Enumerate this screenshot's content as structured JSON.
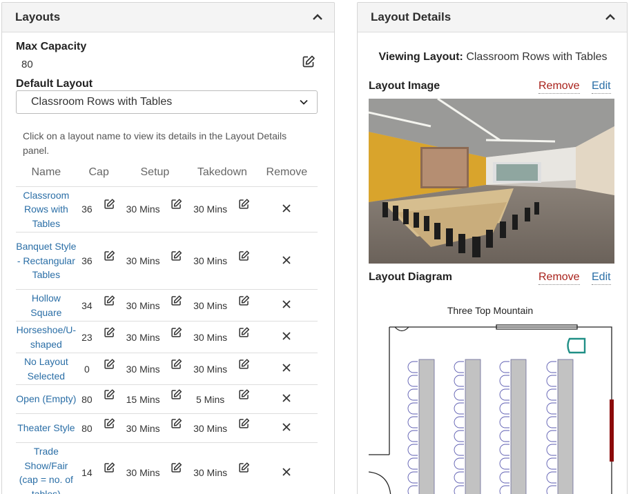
{
  "layouts_panel": {
    "title": "Layouts",
    "max_capacity_label": "Max Capacity",
    "max_capacity_value": "80",
    "default_layout_label": "Default Layout",
    "default_layout_value": "Classroom Rows with Tables",
    "help_text": "Click on a layout name to view its details in the Layout Details panel.",
    "columns": [
      "Name",
      "Cap",
      "Setup",
      "Takedown",
      "Remove"
    ],
    "rows": [
      {
        "name": "Classroom Rows with Tables",
        "cap": "36",
        "setup": "30 Mins",
        "takedown": "30 Mins"
      },
      {
        "name": "Banquet Style - Rectangular Tables",
        "cap": "36",
        "setup": "30 Mins",
        "takedown": "30 Mins"
      },
      {
        "name": "Hollow Square",
        "cap": "34",
        "setup": "30 Mins",
        "takedown": "30 Mins"
      },
      {
        "name": "Horseshoe/U-shaped",
        "cap": "23",
        "setup": "30 Mins",
        "takedown": "30 Mins"
      },
      {
        "name": "No Layout Selected",
        "cap": "0",
        "setup": "30 Mins",
        "takedown": "30 Mins"
      },
      {
        "name": "Open (Empty)",
        "cap": "80",
        "setup": "15 Mins",
        "takedown": "5 Mins"
      },
      {
        "name": "Theater Style",
        "cap": "80",
        "setup": "30 Mins",
        "takedown": "30 Mins"
      },
      {
        "name": "Trade Show/Fair (cap = no. of tables)",
        "cap": "14",
        "setup": "30 Mins",
        "takedown": "30 Mins"
      }
    ],
    "icons": {
      "edit": "edit-icon",
      "remove": "close-icon",
      "collapse": "chevron-up-icon",
      "dropdown": "chevron-down-icon"
    }
  },
  "details_panel": {
    "title": "Layout Details",
    "viewing_label": "Viewing Layout:",
    "viewing_value": "Classroom Rows with Tables",
    "image_label": "Layout Image",
    "diagram_label": "Layout Diagram",
    "remove_label": "Remove",
    "edit_label": "Edit",
    "diagram_title": "Three Top Mountain"
  },
  "colors": {
    "link": "#2a6ea6",
    "remove": "#a8201a",
    "header_bg": "#f4f4f4"
  }
}
